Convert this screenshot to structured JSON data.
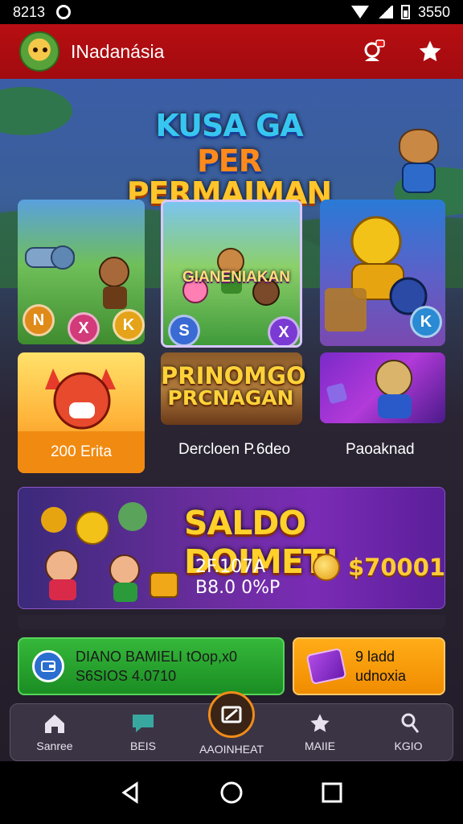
{
  "status_bar": {
    "time": "8213",
    "right_text": "3550"
  },
  "app_bar": {
    "title": "INadanásia"
  },
  "hero": {
    "title_line1_a": "KUSA GA ",
    "title_line1_b": "PER",
    "title_line2": "PERMAIMAN"
  },
  "featured": {
    "title": "GIANENIAKAN"
  },
  "promo_tile": {
    "title_line1": "PRINOMGO",
    "title_line2": "PRCNAGAN"
  },
  "game_cards": [
    {
      "label": "200 Erita"
    },
    {
      "label": "Dercloen P.6deo"
    },
    {
      "label": "Paoaknad"
    }
  ],
  "coins": [
    "N",
    "X",
    "K",
    "S",
    "X",
    "K"
  ],
  "balance": {
    "title": "SALDO DOIMET!",
    "stat_line1": "2F.107A",
    "stat_line2": "B8.0 0%P",
    "amount": "$70001"
  },
  "actions": {
    "green_line1": "DIANO BAMIELI tOop,x0",
    "green_line2": "S6SIOS 4.0710",
    "orange_line1": "9 ladd",
    "orange_line2": "udnoxia"
  },
  "bottom_nav": [
    {
      "label": "Sanree",
      "icon": "home-icon"
    },
    {
      "label": "BEIS",
      "icon": "chat-icon"
    },
    {
      "label": "AAOINHEAT",
      "icon": "center-action-icon"
    },
    {
      "label": "MAIIE",
      "icon": "star-icon"
    },
    {
      "label": "KGIO",
      "icon": "profile-icon"
    }
  ],
  "colors": {
    "app_bar": "#b70e12",
    "accent_gold": "#ffc52a",
    "green": "#1b8d23",
    "orange": "#f08c00",
    "purple": "#6b2d9e"
  }
}
